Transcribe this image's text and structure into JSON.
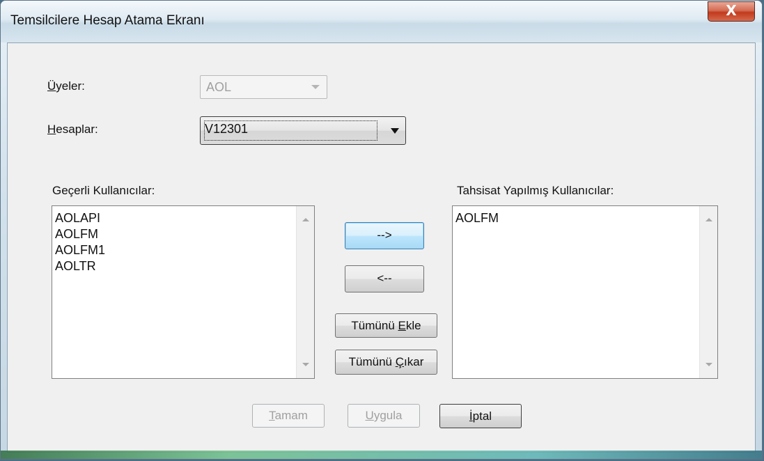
{
  "window": {
    "title": "Temsilcilere Hesap Atama Ekranı",
    "close_glyph": "X"
  },
  "form": {
    "members": {
      "label_hotkey": "Ü",
      "label_rest": "yeler:",
      "value": "AOL",
      "disabled": true
    },
    "accounts": {
      "label_hotkey": "H",
      "label_rest": "esaplar:",
      "value": "V12301"
    }
  },
  "available_users": {
    "label": "Geçerli Kullanıcılar:",
    "items": [
      "AOLAPI",
      "AOLFM",
      "AOLFM1",
      "AOLTR"
    ]
  },
  "assigned_users": {
    "label": "Tahsisat Yapılmış Kullanıcılar:",
    "items": [
      "AOLFM"
    ]
  },
  "transfer_buttons": {
    "move_right": "-->",
    "move_left": "<--",
    "add_all_pre": "Tümünü ",
    "add_all_hotkey": "E",
    "add_all_post": "kle",
    "remove_all_pre": "Tümünü ",
    "remove_all_hotkey": "Ç",
    "remove_all_post": "ıkar"
  },
  "footer": {
    "ok_hotkey": "T",
    "ok_rest": "amam",
    "apply_hotkey": "U",
    "apply_rest": "ygula",
    "cancel_hotkey": "İ",
    "cancel_rest": "ptal"
  }
}
